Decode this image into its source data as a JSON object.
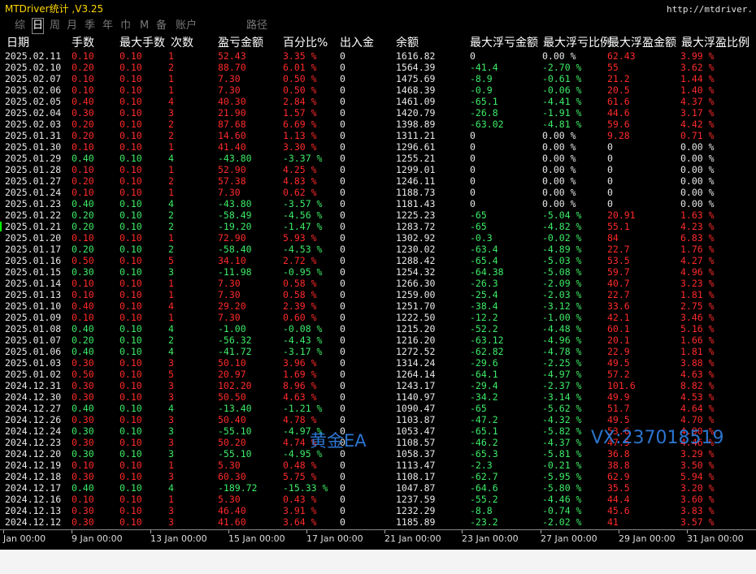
{
  "app": {
    "title": "MTDriver统计 ,V3.25",
    "url": "http://mtdriver."
  },
  "tabs": [
    {
      "label": "综",
      "active": false
    },
    {
      "label": "日",
      "active": true
    },
    {
      "label": "周",
      "active": false
    },
    {
      "label": "月",
      "active": false
    },
    {
      "label": "季",
      "active": false
    },
    {
      "label": "年",
      "active": false
    },
    {
      "label": "巾",
      "active": false
    },
    {
      "label": "M",
      "active": false
    },
    {
      "label": "备",
      "active": false
    },
    {
      "label": "账户",
      "active": false
    },
    {
      "label": "路径",
      "active": false
    }
  ],
  "columns": [
    "日期",
    "手数",
    "最大手数",
    "次数",
    "盈亏金额",
    "百分比%",
    "出入金",
    "余额",
    "最大浮亏金额",
    "最大浮亏比例",
    "最大浮盈金额",
    "最大浮盈比例"
  ],
  "rows": [
    [
      "2025.02.11",
      "0.10",
      "0.10",
      "1",
      "52.43",
      "3.35 %",
      "0",
      "1616.82",
      "0",
      "0.00 %",
      "62.43",
      "3.99 %"
    ],
    [
      "2025.02.10",
      "0.20",
      "0.10",
      "2",
      "88.70",
      "6.01 %",
      "0",
      "1564.39",
      "-41.4",
      "-2.70 %",
      "55",
      "3.62 %"
    ],
    [
      "2025.02.07",
      "0.10",
      "0.10",
      "1",
      "7.30",
      "0.50 %",
      "0",
      "1475.69",
      "-8.9",
      "-0.61 %",
      "21.2",
      "1.44 %"
    ],
    [
      "2025.02.06",
      "0.10",
      "0.10",
      "1",
      "7.30",
      "0.50 %",
      "0",
      "1468.39",
      "-0.9",
      "-0.06 %",
      "20.5",
      "1.40 %"
    ],
    [
      "2025.02.05",
      "0.40",
      "0.10",
      "4",
      "40.30",
      "2.84 %",
      "0",
      "1461.09",
      "-65.1",
      "-4.41 %",
      "61.6",
      "4.37 %"
    ],
    [
      "2025.02.04",
      "0.30",
      "0.10",
      "3",
      "21.90",
      "1.57 %",
      "0",
      "1420.79",
      "-26.8",
      "-1.91 %",
      "44.6",
      "3.17 %"
    ],
    [
      "2025.02.03",
      "0.20",
      "0.10",
      "2",
      "87.68",
      "6.69 %",
      "0",
      "1398.89",
      "-63.02",
      "-4.81 %",
      "59.6",
      "4.42 %"
    ],
    [
      "2025.01.31",
      "0.20",
      "0.10",
      "2",
      "14.60",
      "1.13 %",
      "0",
      "1311.21",
      "0",
      "0.00 %",
      "9.28",
      "0.71 %"
    ],
    [
      "2025.01.30",
      "0.10",
      "0.10",
      "1",
      "41.40",
      "3.30 %",
      "0",
      "1296.61",
      "0",
      "0.00 %",
      "0",
      "0.00 %"
    ],
    [
      "2025.01.29",
      "0.40",
      "0.10",
      "4",
      "-43.80",
      "-3.37 %",
      "0",
      "1255.21",
      "0",
      "0.00 %",
      "0",
      "0.00 %"
    ],
    [
      "2025.01.28",
      "0.10",
      "0.10",
      "1",
      "52.90",
      "4.25 %",
      "0",
      "1299.01",
      "0",
      "0.00 %",
      "0",
      "0.00 %"
    ],
    [
      "2025.01.27",
      "0.20",
      "0.10",
      "2",
      "57.38",
      "4.83 %",
      "0",
      "1246.11",
      "0",
      "0.00 %",
      "0",
      "0.00 %"
    ],
    [
      "2025.01.24",
      "0.10",
      "0.10",
      "1",
      "7.30",
      "0.62 %",
      "0",
      "1188.73",
      "0",
      "0.00 %",
      "0",
      "0.00 %"
    ],
    [
      "2025.01.23",
      "0.40",
      "0.10",
      "4",
      "-43.80",
      "-3.57 %",
      "0",
      "1181.43",
      "0",
      "0.00 %",
      "0",
      "0.00 %"
    ],
    [
      "2025.01.22",
      "0.20",
      "0.10",
      "2",
      "-58.49",
      "-4.56 %",
      "0",
      "1225.23",
      "-65",
      "-5.04 %",
      "20.91",
      "1.63 %"
    ],
    [
      "2025.01.21",
      "0.20",
      "0.10",
      "2",
      "-19.20",
      "-1.47 %",
      "0",
      "1283.72",
      "-65",
      "-4.82 %",
      "55.1",
      "4.23 %"
    ],
    [
      "2025.01.20",
      "0.10",
      "0.10",
      "1",
      "72.90",
      "5.93 %",
      "0",
      "1302.92",
      "-0.3",
      "-0.02 %",
      "84",
      "6.83 %"
    ],
    [
      "2025.01.17",
      "0.20",
      "0.10",
      "2",
      "-58.40",
      "-4.53 %",
      "0",
      "1230.02",
      "-63.4",
      "-4.89 %",
      "22.7",
      "1.76 %"
    ],
    [
      "2025.01.16",
      "0.50",
      "0.10",
      "5",
      "34.10",
      "2.72 %",
      "0",
      "1288.42",
      "-65.4",
      "-5.03 %",
      "53.5",
      "4.27 %"
    ],
    [
      "2025.01.15",
      "0.30",
      "0.10",
      "3",
      "-11.98",
      "-0.95 %",
      "0",
      "1254.32",
      "-64.38",
      "-5.08 %",
      "59.7",
      "4.96 %"
    ],
    [
      "2025.01.14",
      "0.10",
      "0.10",
      "1",
      "7.30",
      "0.58 %",
      "0",
      "1266.30",
      "-26.3",
      "-2.09 %",
      "40.7",
      "3.23 %"
    ],
    [
      "2025.01.13",
      "0.10",
      "0.10",
      "1",
      "7.30",
      "0.58 %",
      "0",
      "1259.00",
      "-25.4",
      "-2.03 %",
      "22.7",
      "1.81 %"
    ],
    [
      "2025.01.10",
      "0.40",
      "0.10",
      "4",
      "29.20",
      "2.39 %",
      "0",
      "1251.70",
      "-38.4",
      "-3.12 %",
      "33.6",
      "2.75 %"
    ],
    [
      "2025.01.09",
      "0.10",
      "0.10",
      "1",
      "7.30",
      "0.60 %",
      "0",
      "1222.50",
      "-12.2",
      "-1.00 %",
      "42.1",
      "3.46 %"
    ],
    [
      "2025.01.08",
      "0.40",
      "0.10",
      "4",
      "-1.00",
      "-0.08 %",
      "0",
      "1215.20",
      "-52.2",
      "-4.48 %",
      "60.1",
      "5.16 %"
    ],
    [
      "2025.01.07",
      "0.20",
      "0.10",
      "2",
      "-56.32",
      "-4.43 %",
      "0",
      "1216.20",
      "-63.12",
      "-4.96 %",
      "20.1",
      "1.66 %"
    ],
    [
      "2025.01.06",
      "0.40",
      "0.10",
      "4",
      "-41.72",
      "-3.17 %",
      "0",
      "1272.52",
      "-62.82",
      "-4.78 %",
      "22.9",
      "1.81 %"
    ],
    [
      "2025.01.03",
      "0.30",
      "0.10",
      "3",
      "50.10",
      "3.96 %",
      "0",
      "1314.24",
      "-29.6",
      "-2.25 %",
      "49.5",
      "3.88 %"
    ],
    [
      "2025.01.02",
      "0.50",
      "0.10",
      "5",
      "20.97",
      "1.69 %",
      "0",
      "1264.14",
      "-64.1",
      "-4.97 %",
      "57.2",
      "4.63 %"
    ],
    [
      "2024.12.31",
      "0.30",
      "0.10",
      "3",
      "102.20",
      "8.96 %",
      "0",
      "1243.17",
      "-29.4",
      "-2.37 %",
      "101.6",
      "8.82 %"
    ],
    [
      "2024.12.30",
      "0.30",
      "0.10",
      "3",
      "50.50",
      "4.63 %",
      "0",
      "1140.97",
      "-34.2",
      "-3.14 %",
      "49.9",
      "4.53 %"
    ],
    [
      "2024.12.27",
      "0.40",
      "0.10",
      "4",
      "-13.40",
      "-1.21 %",
      "0",
      "1090.47",
      "-65",
      "-5.62 %",
      "51.7",
      "4.64 %"
    ],
    [
      "2024.12.26",
      "0.30",
      "0.10",
      "3",
      "50.40",
      "4.78 %",
      "0",
      "1103.87",
      "-47.2",
      "-4.32 %",
      "49.5",
      "4.70 %"
    ],
    [
      "2024.12.24",
      "0.30",
      "0.10",
      "3",
      "-55.10",
      "-4.97 %",
      "0",
      "1053.47",
      "-65.1",
      "-5.82 %",
      "53.6",
      "4.90 %"
    ],
    [
      "2024.12.23",
      "0.30",
      "0.10",
      "3",
      "50.20",
      "4.74 %",
      "0",
      "1108.57",
      "-46.2",
      "-4.37 %",
      "47.5",
      "4.46 %"
    ],
    [
      "2024.12.20",
      "0.30",
      "0.10",
      "3",
      "-55.10",
      "-4.95 %",
      "0",
      "1058.37",
      "-65.3",
      "-5.81 %",
      "36.8",
      "3.29 %"
    ],
    [
      "2024.12.19",
      "0.10",
      "0.10",
      "1",
      "5.30",
      "0.48 %",
      "0",
      "1113.47",
      "-2.3",
      "-0.21 %",
      "38.8",
      "3.50 %"
    ],
    [
      "2024.12.18",
      "0.30",
      "0.10",
      "3",
      "60.30",
      "5.75 %",
      "0",
      "1108.17",
      "-62.7",
      "-5.95 %",
      "62.9",
      "5.94 %"
    ],
    [
      "2024.12.17",
      "0.40",
      "0.10",
      "4",
      "-189.72",
      "-15.33 %",
      "0",
      "1047.87",
      "-64.6",
      "-5.80 %",
      "35.5",
      "3.20 %"
    ],
    [
      "2024.12.16",
      "0.10",
      "0.10",
      "1",
      "5.30",
      "0.43 %",
      "0",
      "1237.59",
      "-55.2",
      "-4.46 %",
      "44.4",
      "3.60 %"
    ],
    [
      "2024.12.13",
      "0.30",
      "0.10",
      "3",
      "46.40",
      "3.91 %",
      "0",
      "1232.29",
      "-8.8",
      "-0.74 %",
      "45.6",
      "3.83 %"
    ],
    [
      "2024.12.12",
      "0.30",
      "0.10",
      "3",
      "41.60",
      "3.64 %",
      "0",
      "1185.89",
      "-23.2",
      "-2.02 %",
      "41",
      "3.57 %"
    ]
  ],
  "timeaxis": [
    "Jan 00:00",
    "9 Jan 00:00",
    "13 Jan 00:00",
    "15 Jan 00:00",
    "17 Jan 00:00",
    "21 Jan 00:00",
    "23 Jan 00:00",
    "27 Jan 00:00",
    "29 Jan 00:00",
    "31 Jan 00:00"
  ],
  "watermarks": {
    "left": "黄金EA",
    "right": "VX:237018519"
  },
  "colors": {
    "profit": "#ff2a2a",
    "loss": "#3ded67",
    "title": "#ffd700",
    "watermark": "#2f7fe0"
  }
}
